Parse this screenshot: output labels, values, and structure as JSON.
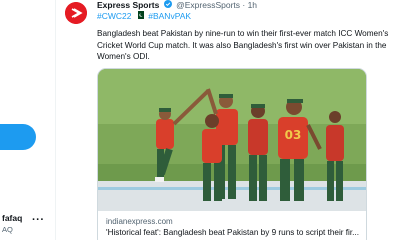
{
  "sidebar": {
    "user_name": "fafaq",
    "user_handle": "AQ",
    "more_label": "···"
  },
  "tweet": {
    "author_name": "Express Sports",
    "author_handle": "@ExpressSports · 1h",
    "hashtags": [
      "#CWC22",
      "#BANvPAK"
    ],
    "text": "Bangladesh beat Pakistan by nine-run to win their first-ever match ICC Women's Cricket World Cup match. It was also Bangladesh's first win over Pakistan in the Women's ODI.",
    "avatar_icon": "express-logo-icon",
    "badge_icon": "verified-badge-icon",
    "flag_icon": "pakistan-flag-icon"
  },
  "card": {
    "domain": "indianexpress.com",
    "title": "'Historical feat': Bangladesh beat Pakistan by 9 runs to script their fir...",
    "players_jerseys": [
      "03"
    ]
  },
  "colors": {
    "accent_blue": "#1d9bf0",
    "brand_red": "#e51b23",
    "text_secondary": "#536471"
  }
}
